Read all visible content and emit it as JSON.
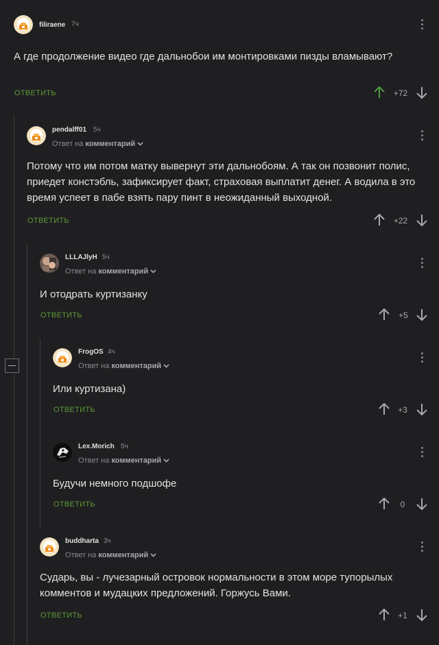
{
  "common": {
    "reply_label": "ОТВЕТИТЬ",
    "reply_to_prefix": "Ответ на",
    "reply_to_link": "комментарий"
  },
  "colors": {
    "background": "#1f1f21",
    "reply_green": "#5e9a38",
    "upvote_active": "#4f9a3f",
    "muted": "#8b8b8f"
  },
  "comments": [
    {
      "username": "filiraene",
      "time": "7ч",
      "avatar_icon": "pikabu-default-avatar-icon",
      "text": "А где продолжение видео где дальнобои им монтировками пизды вламывают?",
      "rating": "+72",
      "upvoted": true
    },
    {
      "username": "pendalff01",
      "time": "5ч",
      "avatar_icon": "pikabu-default-avatar-icon",
      "text": "Потому что им потом матку вывернут эти дальнобоям. А так он позвонит полис, приедет констэбль, зафиксирует факт, страховая выплатит денег. А водила в это время успеет в пабе взять пару пинт в неожиданный выходной.",
      "rating": "+22"
    },
    {
      "username": "LLLAJlyH",
      "time": "5ч",
      "avatar_icon": "user-photo-avatar-icon",
      "text": "И отодрать куртизанку",
      "rating": "+5"
    },
    {
      "username": "FrogOS",
      "time": "4ч",
      "avatar_icon": "pikabu-default-avatar-icon",
      "text": "Или куртизана)",
      "rating": "+3"
    },
    {
      "username": "Lex.Morich",
      "time": "5ч",
      "avatar_icon": "character-avatar-icon",
      "text": "Будучи немного подшофе",
      "rating": "0"
    },
    {
      "username": "buddharta",
      "time": "3ч",
      "avatar_icon": "pikabu-default-avatar-icon",
      "text": "Сударь, вы - лучезарный островок нормальности в этом море тупорылых комментов и мудацких предложений. Горжусь Вами.",
      "rating": "+1"
    }
  ]
}
